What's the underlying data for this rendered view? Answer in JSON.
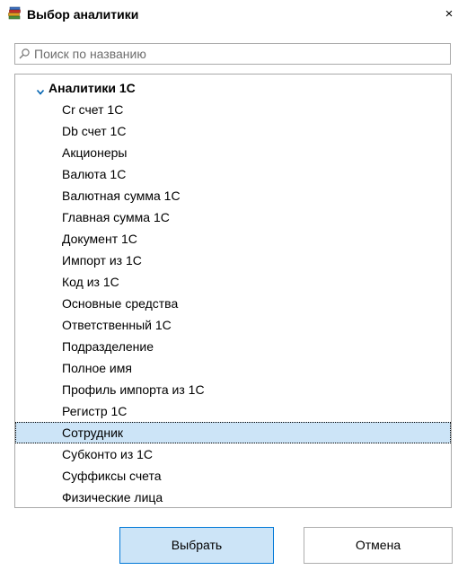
{
  "window": {
    "title": "Выбор аналитики",
    "close_glyph": "×",
    "app_icon": "books-stack-icon"
  },
  "search": {
    "value": "",
    "placeholder": "Поиск по названию",
    "icon": "search-icon"
  },
  "tree": {
    "root_label": "Аналитики 1С",
    "expanded": true,
    "selected_index": 15,
    "items": [
      {
        "label": "Cr счет 1С"
      },
      {
        "label": "Db счет 1С"
      },
      {
        "label": "Акционеры"
      },
      {
        "label": "Валюта 1С"
      },
      {
        "label": "Валютная сумма 1С"
      },
      {
        "label": "Главная сумма 1С"
      },
      {
        "label": "Документ 1С"
      },
      {
        "label": "Импорт из 1С"
      },
      {
        "label": "Код из 1С"
      },
      {
        "label": "Основные средства"
      },
      {
        "label": "Ответственный 1С"
      },
      {
        "label": "Подразделение"
      },
      {
        "label": "Полное имя"
      },
      {
        "label": "Профиль импорта из 1С"
      },
      {
        "label": "Регистр 1С"
      },
      {
        "label": "Сотрудник"
      },
      {
        "label": "Субконто из 1С"
      },
      {
        "label": "Суффиксы счета"
      },
      {
        "label": "Физические лица"
      }
    ]
  },
  "buttons": {
    "ok_label": "Выбрать",
    "cancel_label": "Отмена"
  },
  "colors": {
    "selection": "#cce4f7",
    "accent": "#0078d7",
    "border": "#a9a9a9",
    "arrow": "#0063b1"
  }
}
